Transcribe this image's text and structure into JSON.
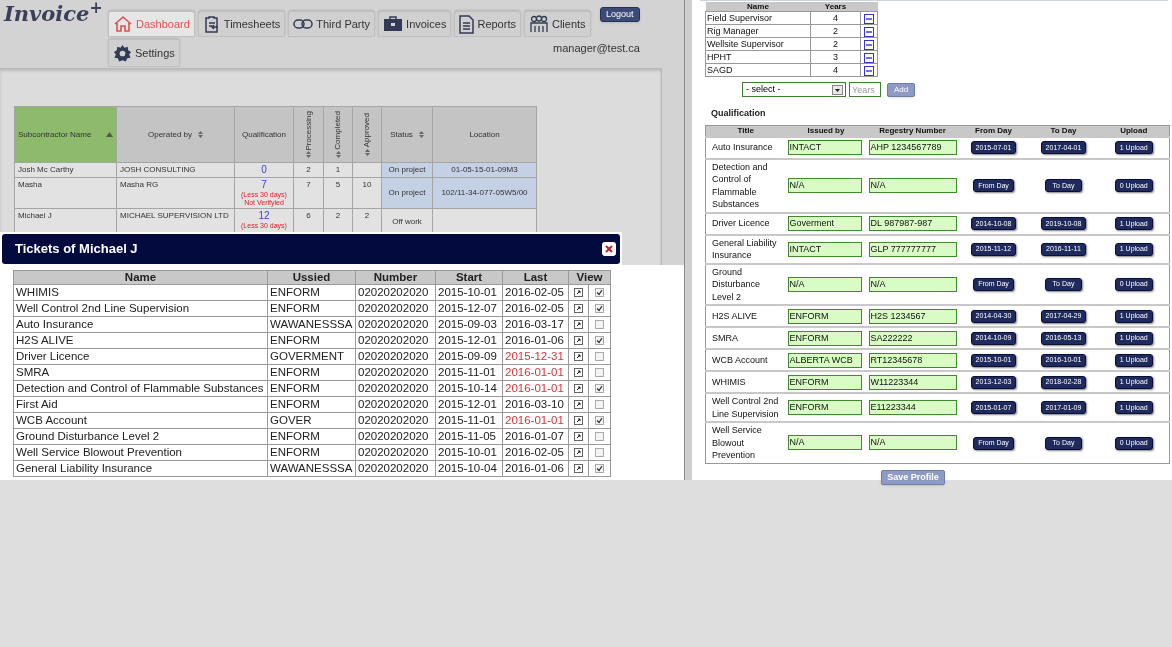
{
  "logo": "Invoice$^{+}$",
  "tabs": [
    {
      "label": "Dashboard",
      "selected": true
    },
    {
      "label": "Timesheets",
      "selected": false
    },
    {
      "label": "Third Party",
      "selected": false
    },
    {
      "label": "Invoices",
      "selected": false
    },
    {
      "label": "Reports",
      "selected": false
    },
    {
      "label": "Clients",
      "selected": false
    },
    {
      "label": "Settings",
      "selected": false
    }
  ],
  "logout_button": "Logout",
  "user_email": "manager@test.ca",
  "subcontractors": {
    "columns": [
      {
        "label": "Subcontractor Name",
        "sortable": true,
        "selected": true
      },
      {
        "label": "Operated by",
        "sortable": true,
        "selected": false
      },
      {
        "label": "Qualification",
        "sortable": false,
        "selected": false
      },
      {
        "label": "Processing",
        "sortable": true,
        "selected": false
      },
      {
        "label": "Completed",
        "sortable": true,
        "selected": false
      },
      {
        "label": "Approved",
        "sortable": true,
        "selected": false
      },
      {
        "label": "Status",
        "sortable": true,
        "selected": false
      },
      {
        "label": "Location",
        "sortable": false,
        "selected": false
      }
    ],
    "rows": [
      {
        "name": "Josh Mc Carthy",
        "operated_by": "JOSH CONSULTING",
        "qualification": "0",
        "processing": "2",
        "completed": "1",
        "status": "On project",
        "location": "01-05-15-01-09M3",
        "highlighted": true
      },
      {
        "name": "Masha",
        "operated_by": "Masha RG",
        "qualification": "7",
        "notes": [
          "(Less 30 days)",
          "Not Verifyied"
        ],
        "processing": "7",
        "completed": "5",
        "approved": "10",
        "status": "On project",
        "location": "102/11-34-077-05W5/00",
        "highlighted": true
      },
      {
        "name": "Michael J",
        "operated_by": "MICHAEL SUPERVISION LTD",
        "qualification": "12",
        "notes": [
          "(Less 30 days)"
        ],
        "processing": "6",
        "completed": "2",
        "approved": "2",
        "status": "Off work",
        "highlighted": false
      }
    ]
  },
  "tickets_dialog": {
    "title": "Tickets of Michael J",
    "columns": [
      "Name",
      "Ussied",
      "Number",
      "Start",
      "Last",
      "View"
    ],
    "rows": [
      {
        "name": "WHIMIS",
        "issued": "ENFORM",
        "number": "02020202020",
        "start": "2015-10-01",
        "last": "2016-02-05",
        "expired": false,
        "checked": true
      },
      {
        "name": "Well Control 2nd Line Supervision",
        "issued": "ENFORM",
        "number": "02020202020",
        "start": "2015-12-07",
        "last": "2016-02-05",
        "expired": false,
        "checked": true
      },
      {
        "name": "Auto Insurance",
        "issued": "WAWANESSSA",
        "number": "02020202020",
        "start": "2015-09-03",
        "last": "2016-03-17",
        "expired": false,
        "checked": false
      },
      {
        "name": "H2S ALIVE",
        "issued": "ENFORM",
        "number": "02020202020",
        "start": "2015-12-01",
        "last": "2016-01-06",
        "expired": false,
        "checked": true
      },
      {
        "name": "Driver Licence",
        "issued": "GOVERMENT",
        "number": "02020202020",
        "start": "2015-09-09",
        "last": "2015-12-31",
        "expired": true,
        "checked": false
      },
      {
        "name": "SMRA",
        "issued": "ENFORM",
        "number": "02020202020",
        "start": "2015-11-01",
        "last": "2016-01-01",
        "expired": true,
        "checked": false
      },
      {
        "name": "Detection and Control of Flammable Substances",
        "issued": "ENFORM",
        "number": "02020202020",
        "start": "2015-10-14",
        "last": "2016-01-01",
        "expired": true,
        "checked": true
      },
      {
        "name": "First Aid",
        "issued": "ENFORM",
        "number": "02020202020",
        "start": "2015-12-01",
        "last": "2016-03-10",
        "expired": false,
        "checked": false
      },
      {
        "name": "WCB Account",
        "issued": "GOVER",
        "number": "02020202020",
        "start": "2015-11-01",
        "last": "2016-01-01",
        "expired": true,
        "checked": true
      },
      {
        "name": "Ground Disturbance Level 2",
        "issued": "ENFORM",
        "number": "02020202020",
        "start": "2015-11-05",
        "last": "2016-01-07",
        "expired": false,
        "checked": false
      },
      {
        "name": "Well Service Blowout Prevention",
        "issued": "ENFORM",
        "number": "02020202020",
        "start": "2015-10-01",
        "last": "2016-02-05",
        "expired": false,
        "checked": false
      },
      {
        "name": "General Liability Insurance",
        "issued": "WAWANESSSA",
        "number": "02020202020",
        "start": "2015-10-04",
        "last": "2016-01-06",
        "expired": false,
        "checked": true
      }
    ]
  },
  "experience": {
    "columns": [
      "Name",
      "Years"
    ],
    "rows": [
      {
        "name": "Field Supervisor",
        "years": "4"
      },
      {
        "name": "Rig Manager",
        "years": "2"
      },
      {
        "name": "Wellsite Supervisor",
        "years": "2"
      },
      {
        "name": "HPHT",
        "years": "3"
      },
      {
        "name": "SAGD",
        "years": "4"
      }
    ],
    "select": "- select -",
    "years_placeholder": "Years",
    "add_button": "Add"
  },
  "qualification": {
    "title": "Qualification",
    "columns": [
      "Title",
      "Issued by",
      "Regestry Number",
      "From Day",
      "To Day",
      "Upload"
    ],
    "rows": [
      {
        "title": "Auto Insurance",
        "issued_by": "INTACT",
        "registry_number": "AHP 1234567789",
        "from_day": "2015-07-01",
        "to_day": "2017-04-01",
        "upload": "1 Upload"
      },
      {
        "title": "Detection and Control of Flammable Substances",
        "issued_by": "N/A",
        "registry_number": "N/A",
        "from_day": "From Day",
        "to_day": "To Day",
        "upload": "0 Upload"
      },
      {
        "title": "Driver Licence",
        "issued_by": "Goverment",
        "registry_number": "DL 987987-987",
        "from_day": "2014-10-08",
        "to_day": "2019-10-08",
        "upload": "1 Upload"
      },
      {
        "title": "General Liability Insurance",
        "issued_by": "INTACT",
        "registry_number": "GLP 777777777",
        "from_day": "2015-11-12",
        "to_day": "2016-11-11",
        "upload": "1 Upload"
      },
      {
        "title": "Ground Disturbance Level 2",
        "issued_by": "N/A",
        "registry_number": "N/A",
        "from_day": "From Day",
        "to_day": "To Day",
        "upload": "0 Upload"
      },
      {
        "title": "H2S ALIVE",
        "issued_by": "ENFORM",
        "registry_number": "H2S 1234567",
        "from_day": "2014-04-30",
        "to_day": "2017-04-29",
        "upload": "1 Upload"
      },
      {
        "title": "SMRA",
        "issued_by": "ENFORM",
        "registry_number": "SA222222",
        "from_day": "2014-10-09",
        "to_day": "2016-05-13",
        "upload": "1 Upload"
      },
      {
        "title": "WCB Account",
        "issued_by": "ALBERTA WCB",
        "registry_number": "RT12345678",
        "from_day": "2015-10-01",
        "to_day": "2016-10-01",
        "upload": "1 Upload"
      },
      {
        "title": "WHIMIS",
        "issued_by": "ENFORM",
        "registry_number": "W11223344",
        "from_day": "2013-12-03",
        "to_day": "2018-02-28",
        "upload": "1 Upload"
      },
      {
        "title": "Well Control 2nd Line Supervision",
        "issued_by": "ENFORM",
        "registry_number": "E11223344",
        "from_day": "2015-01-07",
        "to_day": "2017-01-09",
        "upload": "1 Upload"
      },
      {
        "title": "Well Service Blowout Prevention",
        "issued_by": "N/A",
        "registry_number": "N/A",
        "from_day": "From Day",
        "to_day": "To Day",
        "upload": "0 Upload"
      }
    ],
    "save_button": "Save Profile"
  }
}
